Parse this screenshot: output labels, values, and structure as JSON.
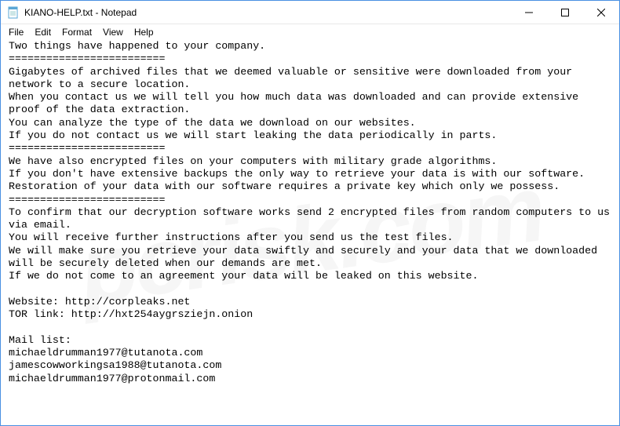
{
  "titlebar": {
    "title": "KIANO-HELP.txt - Notepad",
    "icon": "notepad-icon"
  },
  "window_controls": {
    "minimize": "—",
    "maximize": "☐",
    "close": "✕"
  },
  "menu": {
    "file": "File",
    "edit": "Edit",
    "format": "Format",
    "view": "View",
    "help": "Help"
  },
  "body_text": "Two things have happened to your company.\n=========================\nGigabytes of archived files that we deemed valuable or sensitive were downloaded from your network to a secure location.\nWhen you contact us we will tell you how much data was downloaded and can provide extensive proof of the data extraction.\nYou can analyze the type of the data we download on our websites.\nIf you do not contact us we will start leaking the data periodically in parts.\n=========================\nWe have also encrypted files on your computers with military grade algorithms.\nIf you don't have extensive backups the only way to retrieve your data is with our software.\nRestoration of your data with our software requires a private key which only we possess.\n=========================\nTo confirm that our decryption software works send 2 encrypted files from random computers to us via email.\nYou will receive further instructions after you send us the test files.\nWe will make sure you retrieve your data swiftly and securely and your data that we downloaded will be securely deleted when our demands are met.\nIf we do not come to an agreement your data will be leaked on this website.\n\nWebsite: http://corpleaks.net\nTOR link: http://hxt254aygrsziejn.onion\n\nMail list:\nmichaeldrumman1977@tutanota.com\njamescowworkingsa1988@tutanota.com\nmichaeldrumman1977@protonmail.com",
  "watermark": "pcrisk.com"
}
